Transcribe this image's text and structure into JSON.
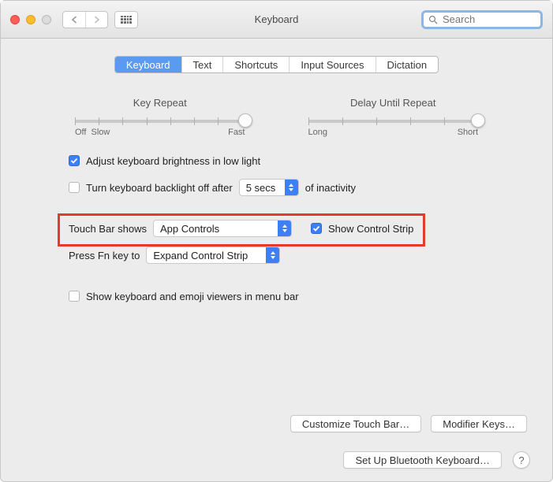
{
  "window_title": "Keyboard",
  "search_placeholder": "Search",
  "tabs": [
    "Keyboard",
    "Text",
    "Shortcuts",
    "Input Sources",
    "Dictation"
  ],
  "slider1": {
    "label": "Key Repeat",
    "left": "Off",
    "left2": "Slow",
    "right": "Fast"
  },
  "slider2": {
    "label": "Delay Until Repeat",
    "left": "Long",
    "right": "Short"
  },
  "row_brightness": "Adjust keyboard brightness in low light",
  "row_backlight_pre": "Turn keyboard backlight off after",
  "row_backlight_val": "5 secs",
  "row_backlight_post": "of inactivity",
  "row_touchbar_label": "Touch Bar shows",
  "row_touchbar_val": "App Controls",
  "row_controlstrip": "Show Control Strip",
  "row_fn_label": "Press Fn key to",
  "row_fn_val": "Expand Control Strip",
  "row_menubar": "Show keyboard and emoji viewers in menu bar",
  "btn_customize": "Customize Touch Bar…",
  "btn_modifier": "Modifier Keys…",
  "btn_bluetooth": "Set Up Bluetooth Keyboard…",
  "help": "?"
}
